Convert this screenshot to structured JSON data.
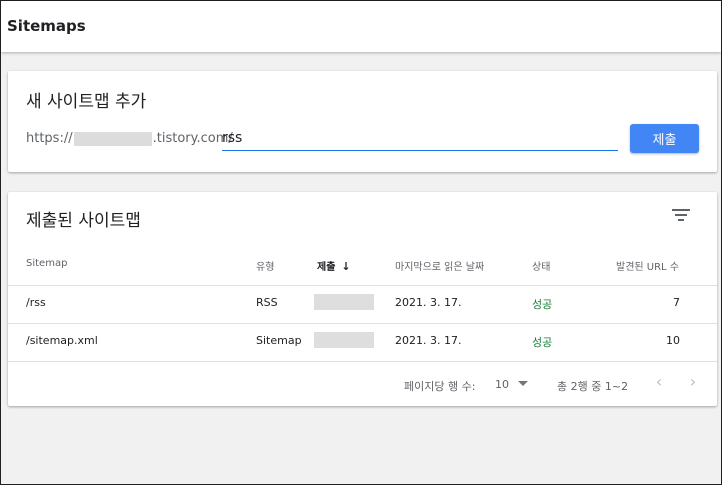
{
  "header": {
    "title": "Sitemaps"
  },
  "add_card": {
    "title": "새 사이트맵 추가",
    "url_prefix_start": "https://",
    "url_prefix_end": ".tistory.com/",
    "input_value": "rss",
    "submit_label": "제출"
  },
  "table_card": {
    "title": "제출된 사이트맵",
    "filter_icon": "filter-icon",
    "columns": {
      "sitemap": "Sitemap",
      "type": "유형",
      "submitted": "제출",
      "last_read": "마지막으로 읽은 날짜",
      "status": "상태",
      "urls": "발견된 URL 수"
    },
    "sort_icon": "arrow-down-icon",
    "rows": [
      {
        "sitemap": "/rss",
        "type": "RSS",
        "last_read": "2021. 3. 17.",
        "status": "성공",
        "urls": "7"
      },
      {
        "sitemap": "/sitemap.xml",
        "type": "Sitemap",
        "last_read": "2021. 3. 17.",
        "status": "성공",
        "urls": "10"
      }
    ],
    "pagination": {
      "rows_per_page_label": "페이지당 행 수:",
      "rows_per_page_value": "10",
      "range_text": "총 2행 중 1~2",
      "prev_icon": "chevron-left-icon",
      "next_icon": "chevron-right-icon"
    }
  },
  "colors": {
    "accent": "#4285f4",
    "input_underline": "#1a73e8",
    "status_success": "#188038"
  }
}
